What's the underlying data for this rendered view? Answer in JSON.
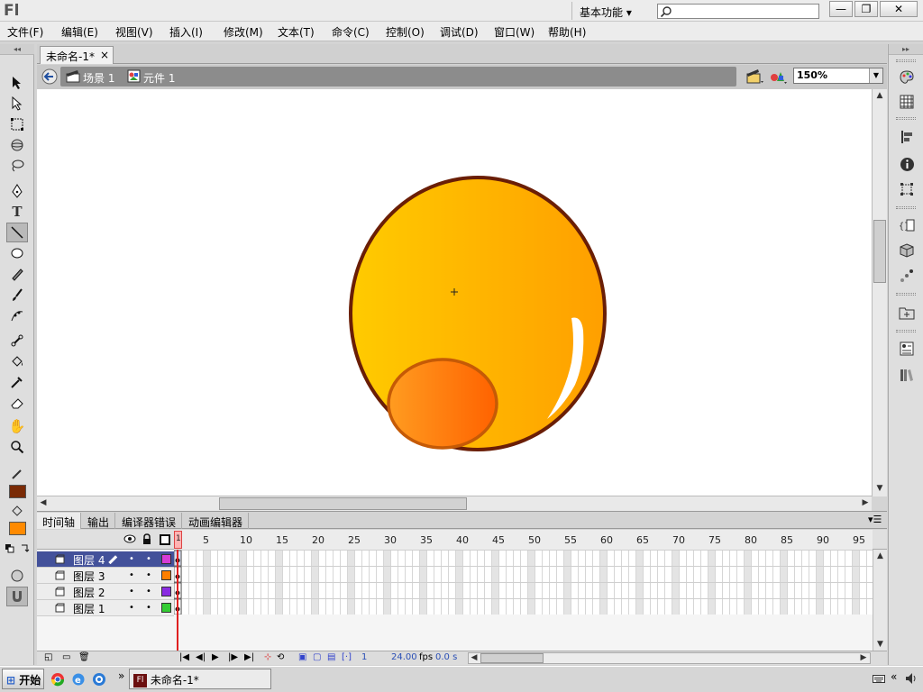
{
  "app": {
    "logo": "Fl",
    "workspace": "基本功能 ▾",
    "search_placeholder": ""
  },
  "window_buttons": {
    "minimize": "—",
    "restore": "❐",
    "close": "✕"
  },
  "menu": [
    "文件(F)",
    "编辑(E)",
    "视图(V)",
    "插入(I)",
    "修改(M)",
    "文本(T)",
    "命令(C)",
    "控制(O)",
    "调试(D)",
    "窗口(W)",
    "帮助(H)"
  ],
  "document": {
    "tab_title": "未命名-1*",
    "tab_close": "×"
  },
  "breadcrumb": {
    "scene": "场景 1",
    "symbol": "元件 1"
  },
  "zoom": "150%",
  "tools": {
    "stroke_color": "#7a2a05",
    "fill_color": "#ff8a00"
  },
  "timeline": {
    "tabs": [
      "时间轴",
      "输出",
      "编译器错误",
      "动画编辑器"
    ],
    "ruler": [
      "1",
      "5",
      "10",
      "15",
      "20",
      "25",
      "30",
      "35",
      "40",
      "45",
      "50",
      "55",
      "60",
      "65",
      "70",
      "75",
      "80",
      "85",
      "90",
      "95"
    ],
    "layers": [
      {
        "name": "图层 4",
        "color": "#d63cd6",
        "selected": true
      },
      {
        "name": "图层 3",
        "color": "#ff7f00",
        "selected": false
      },
      {
        "name": "图层 2",
        "color": "#8a2be2",
        "selected": false
      },
      {
        "name": "图层 1",
        "color": "#33cc33",
        "selected": false
      }
    ],
    "current_frame": "1",
    "fps": "24.00",
    "fps_unit": "fps",
    "time": "0.0 s"
  },
  "taskbar": {
    "start": "开始",
    "task": "未命名-1*",
    "chevron": "»",
    "right_chevron": "«"
  }
}
